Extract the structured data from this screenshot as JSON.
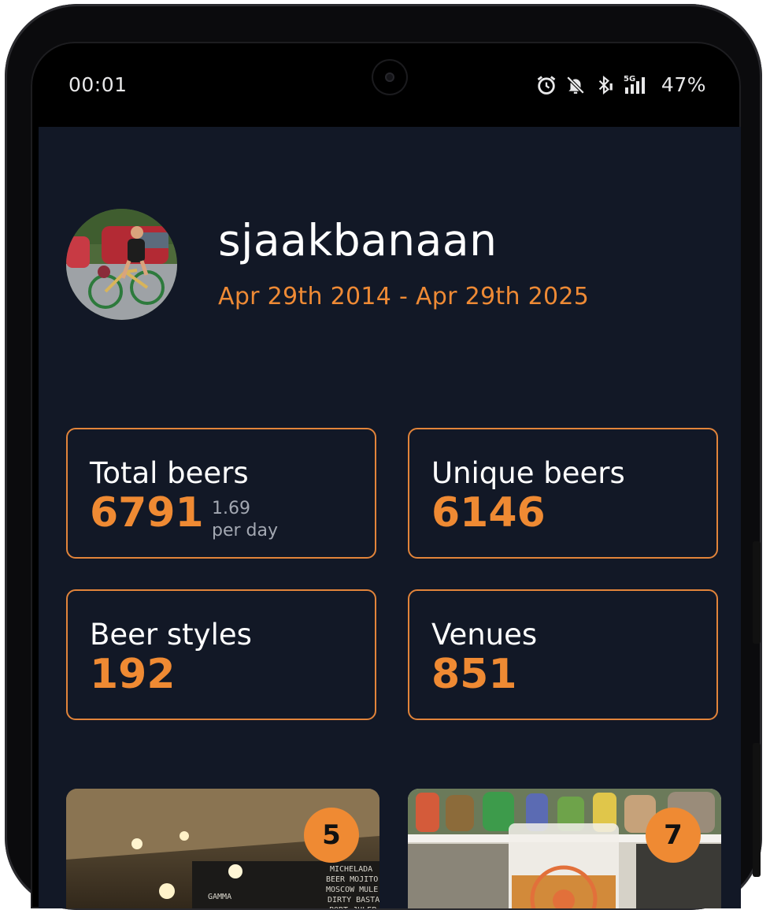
{
  "status_bar": {
    "time": "00:01",
    "network": "5G",
    "battery": "47%"
  },
  "profile": {
    "username": "sjaakbanaan",
    "date_range": "Apr 29th 2014 - Apr 29th 2025"
  },
  "stats": [
    {
      "label": "Total beers",
      "value": "6791",
      "sub_value": "1.69",
      "sub_label": "per day"
    },
    {
      "label": "Unique beers",
      "value": "6146"
    },
    {
      "label": "Beer styles",
      "value": "192"
    },
    {
      "label": "Venues",
      "value": "851"
    }
  ],
  "photo_cards": [
    {
      "badge": "5"
    },
    {
      "badge": "7"
    }
  ],
  "colors": {
    "accent": "#ef8a33",
    "background": "#121826",
    "card_border": "#e2843a"
  }
}
